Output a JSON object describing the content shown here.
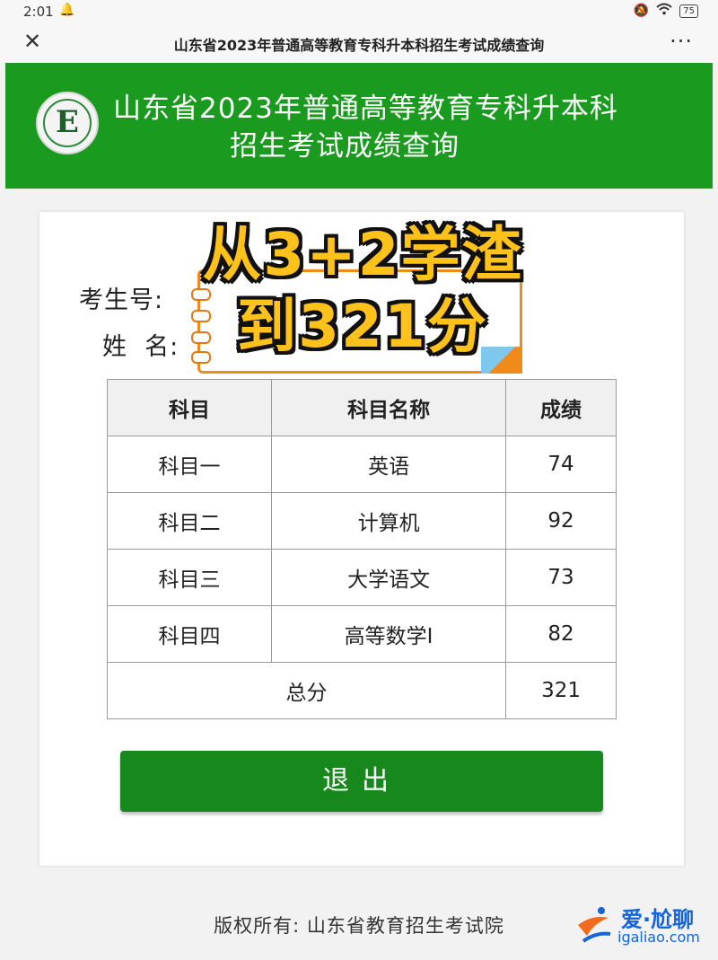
{
  "status_bar": {
    "time": "2:01",
    "battery": "75"
  },
  "nav": {
    "title": "山东省2023年普通高等教育专科升本科招生考试成绩查询",
    "close": "✕",
    "more": "···"
  },
  "header": {
    "title_line1": "山东省2023年普通高等教育专科升本科",
    "title_line2": "招生考试成绩查询",
    "logo_letter": "E"
  },
  "form": {
    "exam_no_label": "考生号:",
    "name_label": "姓  名:"
  },
  "overlay": {
    "line1": "从3+2学渣",
    "line2": "到321分"
  },
  "table": {
    "headers": [
      "科目",
      "科目名称",
      "成绩"
    ],
    "rows": [
      {
        "subject": "科目一",
        "name": "英语",
        "score": "74"
      },
      {
        "subject": "科目二",
        "name": "计算机",
        "score": "92"
      },
      {
        "subject": "科目三",
        "name": "大学语文",
        "score": "73"
      },
      {
        "subject": "科目四",
        "name": "高等数学I",
        "score": "82"
      }
    ],
    "total_label": "总分",
    "total_score": "321"
  },
  "exit_button": "退出",
  "footer": "版权所有:  山东省教育招生考试院",
  "watermark": {
    "line1": "爱·尬聊",
    "line2": "igaliao.com"
  },
  "colors": {
    "header_green": "#1a9a1e",
    "button_green": "#16881c",
    "overlay_yellow": "#ffc21a"
  }
}
